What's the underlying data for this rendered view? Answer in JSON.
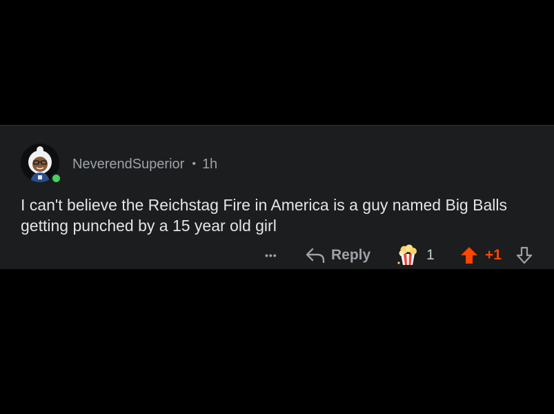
{
  "comment": {
    "username": "NeverendSuperior",
    "separator": "•",
    "age": "1h",
    "text": "I can't believe the Reichstag Fire in America is a guy named Big Balls getting punched by a 15 year old girl"
  },
  "actions": {
    "more_label": "•••",
    "reply_label": "Reply",
    "award_count": "1",
    "score": "+1"
  },
  "icons": {
    "avatar": "snoo-avatar-icon",
    "online": "online-status-icon",
    "reply": "reply-arrow-icon",
    "award": "popcorn-award-icon",
    "upvote": "upvote-arrow-icon",
    "downvote": "downvote-arrow-icon"
  },
  "colors": {
    "background": "#000000",
    "card": "#1b1d1f",
    "text": "#e3e5e8",
    "muted": "#9ea3a8",
    "upvote": "#ff4500",
    "online": "#46d160"
  }
}
